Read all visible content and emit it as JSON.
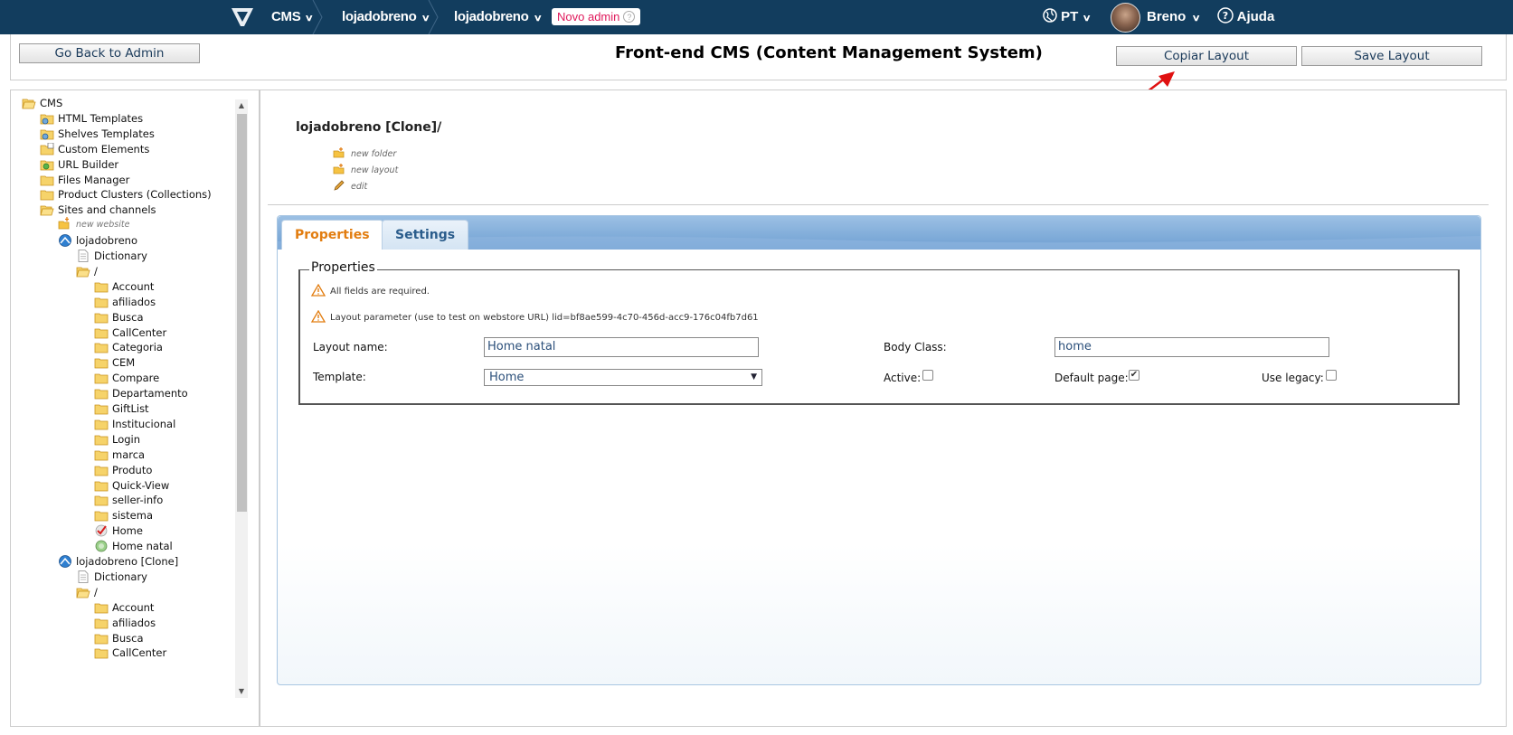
{
  "topbar": {
    "crumbs": [
      "CMS",
      "lojadobreno",
      "lojadobreno"
    ],
    "badge": "Novo admin",
    "badge_help": "?",
    "language": "PT",
    "user": "Breno",
    "help": "Ajuda"
  },
  "header": {
    "back_button": "Go Back to Admin",
    "title": "Front-end CMS (Content Management System)",
    "copy_button": "Copiar Layout",
    "save_button": "Save Layout"
  },
  "tree": {
    "items": [
      {
        "label": "CMS",
        "icon": "folder-open-icon"
      },
      {
        "label": "HTML Templates",
        "icon": "templates-icon"
      },
      {
        "label": "Shelves Templates",
        "icon": "templates-icon"
      },
      {
        "label": "Custom Elements",
        "icon": "custom-elements-icon"
      },
      {
        "label": "URL Builder",
        "icon": "url-builder-icon"
      },
      {
        "label": "Files Manager",
        "icon": "folder-icon"
      },
      {
        "label": "Product Clusters (Collections)",
        "icon": "folder-icon"
      },
      {
        "label": "Sites and channels",
        "icon": "folder-open-icon"
      },
      {
        "label": "new website",
        "icon": "new-folder-icon"
      },
      {
        "label": "lojadobreno",
        "icon": "site-icon"
      },
      {
        "label": "Dictionary",
        "icon": "document-icon"
      },
      {
        "label": "/",
        "icon": "folder-open-icon"
      },
      {
        "label": "Account",
        "icon": "folder-icon"
      },
      {
        "label": "afiliados",
        "icon": "folder-icon"
      },
      {
        "label": "Busca",
        "icon": "folder-icon"
      },
      {
        "label": "CallCenter",
        "icon": "folder-icon"
      },
      {
        "label": "Categoria",
        "icon": "folder-icon"
      },
      {
        "label": "CEM",
        "icon": "folder-icon"
      },
      {
        "label": "Compare",
        "icon": "folder-icon"
      },
      {
        "label": "Departamento",
        "icon": "folder-icon"
      },
      {
        "label": "GiftList",
        "icon": "folder-icon"
      },
      {
        "label": "Institucional",
        "icon": "folder-icon"
      },
      {
        "label": "Login",
        "icon": "folder-icon"
      },
      {
        "label": "marca",
        "icon": "folder-icon"
      },
      {
        "label": "Produto",
        "icon": "folder-icon"
      },
      {
        "label": "Quick-View",
        "icon": "folder-icon"
      },
      {
        "label": "seller-info",
        "icon": "folder-icon"
      },
      {
        "label": "sistema",
        "icon": "folder-icon"
      },
      {
        "label": "Home",
        "icon": "layout-default-icon"
      },
      {
        "label": "Home natal",
        "icon": "layout-icon"
      },
      {
        "label": "lojadobreno [Clone]",
        "icon": "site-icon"
      },
      {
        "label": "Dictionary",
        "icon": "document-icon"
      },
      {
        "label": "/",
        "icon": "folder-open-icon"
      },
      {
        "label": "Account",
        "icon": "folder-icon"
      },
      {
        "label": "afiliados",
        "icon": "folder-icon"
      },
      {
        "label": "Busca",
        "icon": "folder-icon"
      },
      {
        "label": "CallCenter",
        "icon": "folder-icon"
      }
    ]
  },
  "content": {
    "path_title": "lojadobreno [Clone]/",
    "actions": [
      "new folder",
      "new layout",
      "edit"
    ],
    "tabs": [
      "Properties",
      "Settings"
    ],
    "legend": "Properties",
    "warning_required": "All fields are required.",
    "warning_layout_param": "Layout parameter (use to test on webstore URL) lid=bf8ae599-4c70-456d-acc9-176c04fb7d61",
    "layout_name_label": "Layout name:",
    "layout_name_value": "Home natal",
    "body_class_label": "Body Class:",
    "body_class_value": "home",
    "template_label": "Template:",
    "template_value": "Home",
    "active_label": "Active:",
    "active_checked": false,
    "default_page_label": "Default page:",
    "default_page_checked": true,
    "use_legacy_label": "Use legacy:",
    "use_legacy_checked": false
  },
  "colors": {
    "topbar": "#123d5e",
    "badge_text": "#e0195b",
    "tab_active": "#e27d10",
    "tab_inactive": "#2b5d8c",
    "annotation_arrow": "#e01010"
  }
}
